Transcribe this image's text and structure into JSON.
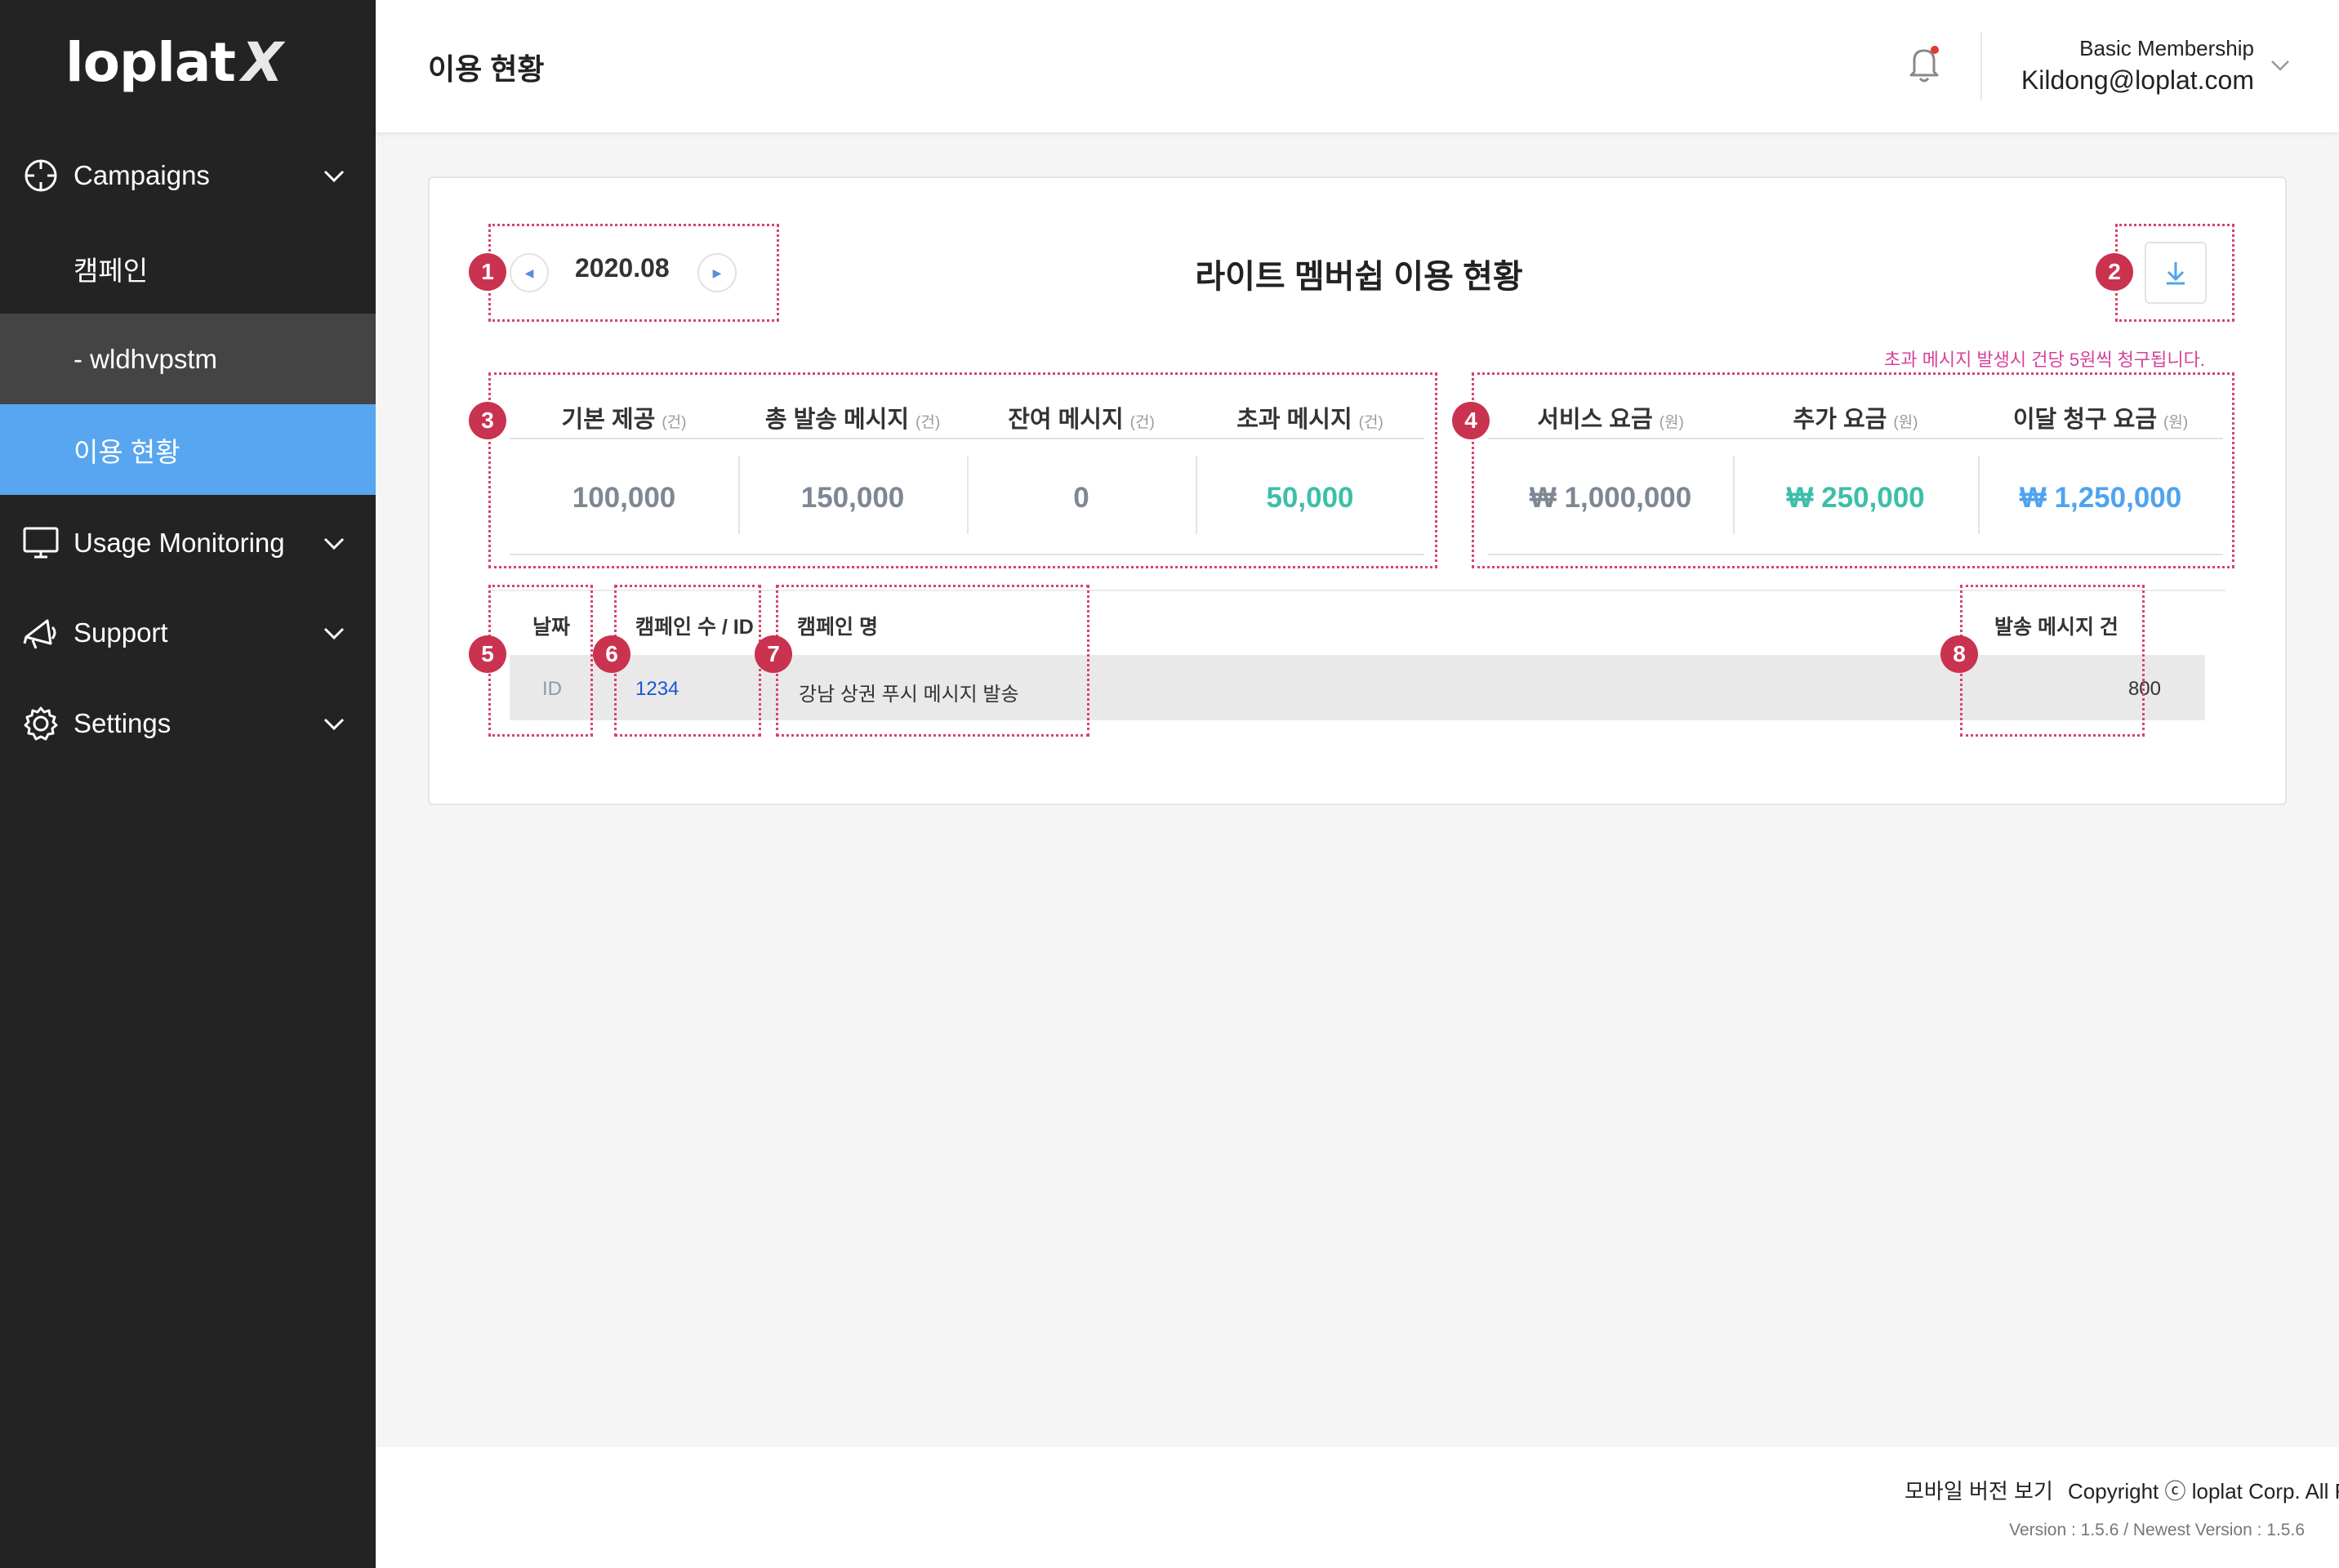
{
  "app": {
    "logo": "loplat",
    "logo_x": "X"
  },
  "sidebar": {
    "campaigns_label": "Campaigns",
    "campaign_sub": "캠페인",
    "selected_sub": "-  wldhvpstm",
    "active_sub": "이용 현황",
    "usage_label": "Usage Monitoring",
    "support_label": "Support",
    "settings_label": "Settings"
  },
  "header": {
    "title": "이용 현황",
    "membership": "Basic Membership",
    "email": "Kildong@loplat.com"
  },
  "card": {
    "period": "2020.08",
    "title": "라이트 멤버쉽 이용 현황",
    "notice": "초과 메시지 발생시 건당 5원씩 청구됩니다.",
    "badges": [
      "1",
      "2",
      "3",
      "4",
      "5",
      "6",
      "7",
      "8"
    ]
  },
  "message_stats": [
    {
      "label": "기본 제공",
      "unit": "(건)",
      "value": "100,000",
      "color": "#7e8794"
    },
    {
      "label": "총 발송 메시지",
      "unit": "(건)",
      "value": "150,000",
      "color": "#7e8794"
    },
    {
      "label": "잔여 메시지",
      "unit": "(건)",
      "value": "0",
      "color": "#7e8794"
    },
    {
      "label": "초과 메시지",
      "unit": "(건)",
      "value": "50,000",
      "color": "#3dbfa8"
    }
  ],
  "fee_stats": [
    {
      "label": "서비스 요금",
      "unit": "(원)",
      "value": "₩ 1,000,000",
      "color": "#7e8794"
    },
    {
      "label": "추가 요금",
      "unit": "(원)",
      "value": "₩ 250,000",
      "color": "#3dbfa8"
    },
    {
      "label": "이달 청구 요금",
      "unit": "(원)",
      "value": "₩ 1,250,000",
      "color": "#4ea3f0"
    }
  ],
  "table": {
    "headers": {
      "date": "날짜",
      "campaign_id": "캠페인 수 / ID",
      "campaign_name": "캠페인 명",
      "sent": "발송 메시지 건"
    },
    "rows": [
      {
        "date": "ID",
        "campaign_id": "1234",
        "campaign_name": "강남 상권 푸시 메시지 발송",
        "sent": "800"
      }
    ]
  },
  "footer": {
    "mobile_link": "모바일 버전 보기",
    "copyright": "Copyright ⓒ loplat Corp. All R",
    "version": "Version : 1.5.6 / Newest Version : 1.5.6"
  },
  "colors": {
    "sidebar_bg": "#232323",
    "active_bg": "#58a5f0",
    "selected_bg": "#444444",
    "accent_teal": "#3dbfa8",
    "accent_blue": "#4ea3f0",
    "annotation": "#c9334f",
    "notice": "#d6419a"
  },
  "icons": [
    "crosshair-icon",
    "monitor-icon",
    "megaphone-icon",
    "gear-icon",
    "chevron-down-icon",
    "bell-icon",
    "download-icon",
    "arrow-left-icon",
    "arrow-right-icon"
  ]
}
